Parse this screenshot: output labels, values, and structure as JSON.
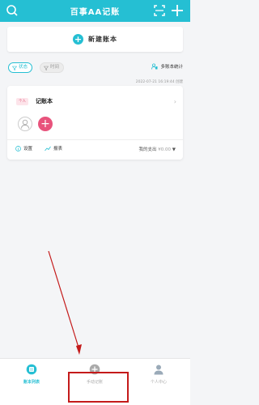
{
  "header": {
    "title": "百事AA记账",
    "accent": "#25bfd3"
  },
  "new_book": {
    "label": "新建账本"
  },
  "filters": [
    {
      "label": "状态"
    },
    {
      "label": "时间"
    }
  ],
  "stats": {
    "label": "多账本统计"
  },
  "book": {
    "created": "2022-07-21 16:19:44 创建",
    "tag": "个人",
    "name": "记账本",
    "settings": "设置",
    "report": "报表",
    "mine_label": "我的支出",
    "mine_amount": "¥0.00"
  },
  "tabs": [
    {
      "label": "账本列表",
      "icon": "book-list-icon"
    },
    {
      "label": "手动记账",
      "icon": "add-record-icon"
    },
    {
      "label": "个人中心",
      "icon": "profile-icon"
    }
  ],
  "colors": {
    "accent": "#25bfd3",
    "pink": "#e8537c",
    "annotation": "#c41a1a"
  }
}
